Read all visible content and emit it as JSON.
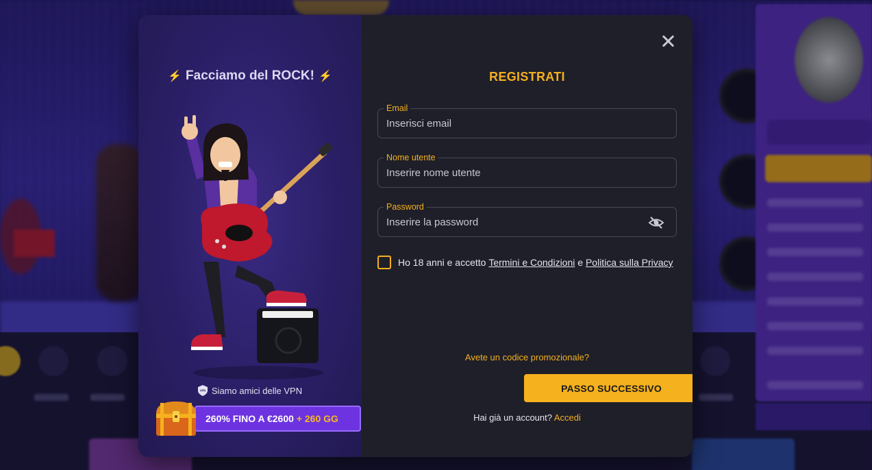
{
  "promo": {
    "title": "Facciamo del ROCK!",
    "vpn_text": "Siamo amici delle VPN",
    "bonus_main": "260% FINO A €2600",
    "bonus_extra": "+ 260 GG"
  },
  "form": {
    "title": "REGISTRATI",
    "email": {
      "label": "Email",
      "placeholder": "Inserisci email",
      "value": ""
    },
    "username": {
      "label": "Nome utente",
      "placeholder": "Inserire nome utente",
      "value": ""
    },
    "password": {
      "label": "Password",
      "placeholder": "Inserire la password",
      "value": ""
    },
    "terms": {
      "prefix": "Ho 18 anni e accetto ",
      "terms_link": "Termini e Condizioni",
      "and": " e ",
      "privacy_link": "Politica sulla Privacy",
      "checked": false
    },
    "promo_code_link": "Avete un codice promozionale?",
    "next_button": "PASSO SUCCESSIVO",
    "login_prompt": "Hai già un account?",
    "login_link": "Accedi"
  },
  "colors": {
    "accent": "#f5b01e",
    "modal_bg": "#1f1f29",
    "promo_bg": "#2a1f66",
    "bonus_bar": "#6d33e0"
  },
  "icons": {
    "close": "close-icon",
    "eye": "eye-slash-icon",
    "shield": "vpn-shield-icon",
    "bolt": "lightning-bolt-icon",
    "chest": "treasure-chest-icon"
  }
}
